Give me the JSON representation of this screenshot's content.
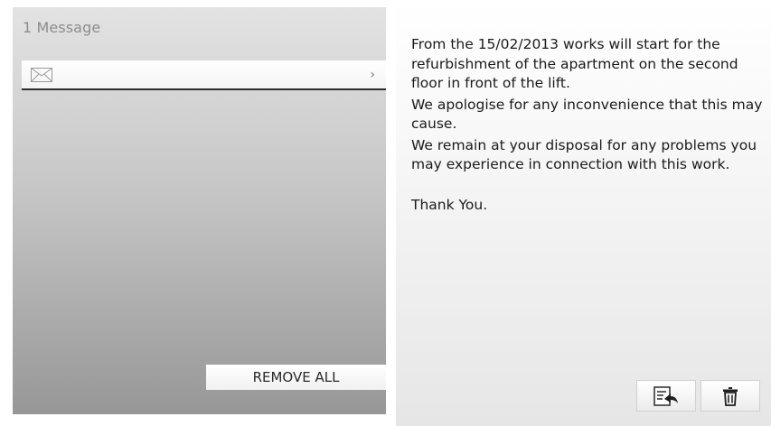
{
  "left_panel": {
    "message_count_label": "1 Message",
    "messages": [
      {
        "icon": "envelope-icon",
        "chevron": "›"
      }
    ],
    "remove_all_label": "REMOVE ALL"
  },
  "message_view": {
    "paragraphs": [
      "From the 15/02/2013 works will start for the refurbishment of the apartment on the second floor in front of the lift.",
      "We apologise for any inconvenience that this may cause.",
      "We remain at your disposal for any problems you may experience in connection with this work."
    ],
    "closing": "Thank You."
  },
  "toolbar": {
    "reply_icon": "reply-message-icon",
    "delete_icon": "trash-icon"
  }
}
